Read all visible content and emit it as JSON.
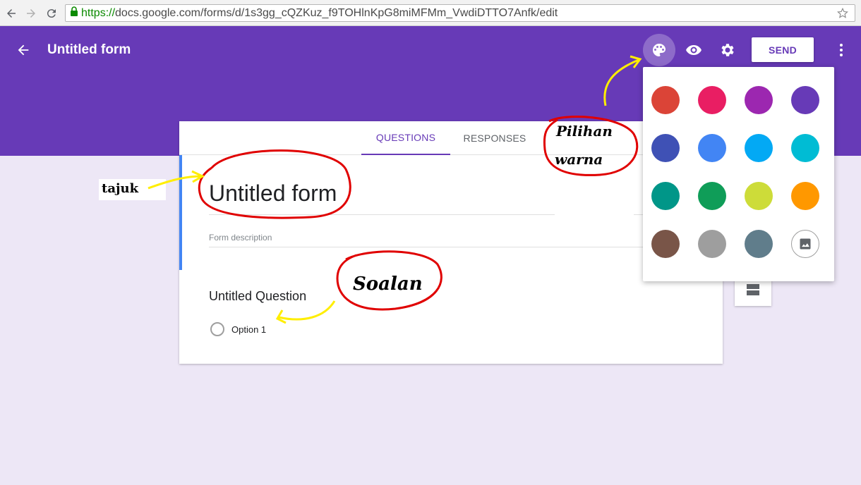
{
  "browser": {
    "url_protocol": "https://",
    "url_rest": "docs.google.com/forms/d/1s3gg_cQZKuz_f9TOHlnKpG8miMFMm_VwdiDTTO7Anfk/edit"
  },
  "header": {
    "title": "Untitled form",
    "send_label": "SEND",
    "icons": [
      "back-arrow-icon",
      "palette-icon",
      "eye-icon",
      "gear-icon",
      "more-vert-icon"
    ]
  },
  "tabs": [
    {
      "label": "QUESTIONS",
      "active": true
    },
    {
      "label": "RESPONSES",
      "active": false
    }
  ],
  "form": {
    "title": "Untitled form",
    "description_placeholder": "Form description",
    "question_title": "Untitled Question",
    "option_label": "Option 1"
  },
  "palette": {
    "colors": [
      "#db4437",
      "#e91e63",
      "#9c27b0",
      "#673ab7",
      "#3f51b5",
      "#4285f4",
      "#03a9f4",
      "#00bcd4",
      "#009688",
      "#0f9d58",
      "#cddc39",
      "#ff9800",
      "#795548",
      "#9e9e9e",
      "#607d8b"
    ],
    "image_option_icon": "image-icon"
  },
  "annotations": {
    "tajuk": "tajuk",
    "pilihan": "Pilihan",
    "warna": "warna",
    "soalan": "Soalan",
    "ink_red": "#e00000",
    "ink_yellow": "#ffee00"
  },
  "colors": {
    "header_purple": "#673ab7",
    "background": "#ede7f6",
    "accent_blue": "#4285f4"
  }
}
